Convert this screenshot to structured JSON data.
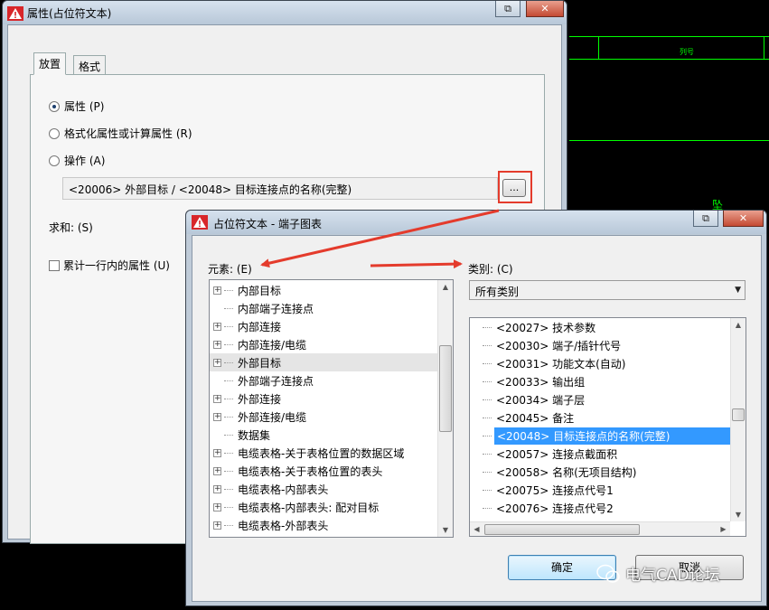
{
  "back_dialog": {
    "title": "属性(占位符文本)",
    "tabs": [
      "放置",
      "格式"
    ],
    "radios": [
      {
        "label": "属性 (P)",
        "checked": true
      },
      {
        "label": "格式化属性或计算属性 (R)",
        "checked": false
      },
      {
        "label": "操作 (A)",
        "checked": false
      }
    ],
    "attribute_value": "<20006> 外部目标 / <20048> 目标连接点的名称(完整)",
    "browse_label": "...",
    "sum_label": "求和: (S)",
    "accumulate_label": "累计一行内的属性 (U)"
  },
  "front_dialog": {
    "title": "占位符文本 - 端子图表",
    "elements_label": "元素: (E)",
    "category_label": "类别: (C)",
    "category_value": "所有类别",
    "elements": [
      {
        "label": "内部目标",
        "expandable": true
      },
      {
        "label": "内部端子连接点",
        "expandable": false
      },
      {
        "label": "内部连接",
        "expandable": true
      },
      {
        "label": "内部连接/电缆",
        "expandable": true
      },
      {
        "label": "外部目标",
        "expandable": true,
        "highlighted": true
      },
      {
        "label": "外部端子连接点",
        "expandable": false
      },
      {
        "label": "外部连接",
        "expandable": true
      },
      {
        "label": "外部连接/电缆",
        "expandable": true
      },
      {
        "label": "数据集",
        "expandable": false
      },
      {
        "label": "电缆表格-关于表格位置的数据区域",
        "expandable": true
      },
      {
        "label": "电缆表格-关于表格位置的表头",
        "expandable": true
      },
      {
        "label": "电缆表格-内部表头",
        "expandable": true
      },
      {
        "label": "电缆表格-内部表头: 配对目标",
        "expandable": true
      },
      {
        "label": "电缆表格-外部表头",
        "expandable": true
      }
    ],
    "properties": [
      {
        "label": "<20027> 技术参数",
        "selected": false
      },
      {
        "label": "<20030> 端子/插针代号",
        "selected": false
      },
      {
        "label": "<20031> 功能文本(自动)",
        "selected": false
      },
      {
        "label": "<20033> 输出组",
        "selected": false
      },
      {
        "label": "<20034> 端子层",
        "selected": false
      },
      {
        "label": "<20045> 备注",
        "selected": false
      },
      {
        "label": "<20048> 目标连接点的名称(完整)",
        "selected": true
      },
      {
        "label": "<20057> 连接点截面积",
        "selected": false
      },
      {
        "label": "<20058> 名称(无项目结构)",
        "selected": false
      },
      {
        "label": "<20075> 连接点代号1",
        "selected": false
      },
      {
        "label": "<20076> 连接点代号2",
        "selected": false
      }
    ],
    "ok_label": "确定",
    "cancel_label": "取消"
  },
  "background": {
    "cad_label": "列号",
    "cad_char": "坠"
  },
  "watermark": "电气CAD论坛",
  "colors": {
    "annotation": "#e43b2c",
    "selection": "#3399ff",
    "cad_lines": "#00ff00"
  }
}
